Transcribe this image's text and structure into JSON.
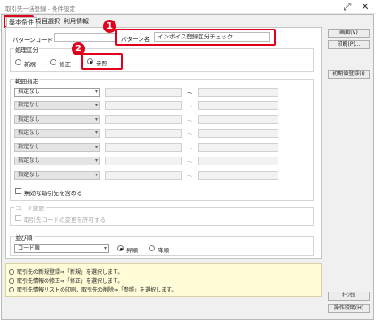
{
  "window": {
    "title": "取引先一括登録 - 条件設定"
  },
  "tabs": [
    "基本条件",
    "項目選択",
    "利用情報"
  ],
  "pattern": {
    "code_label": "パターンコード",
    "name_label": "パターン名",
    "name_value": "インボイス登録区分チェック"
  },
  "process": {
    "label": "処理区分",
    "options": [
      "新規",
      "修正",
      "参照"
    ],
    "selected": "参照"
  },
  "range": {
    "label": "範囲指定",
    "first_value": "指定なし",
    "rows": [
      "指定なし",
      "指定なし",
      "指定なし",
      "指定なし",
      "指定なし",
      "指定なし",
      "指定なし",
      "指定なし"
    ],
    "tilde": "～"
  },
  "include_invalid": {
    "label": "無効な取引先を含める"
  },
  "code_change": {
    "label": "コード変更",
    "allow_label": "取引先コードの変更を許可する"
  },
  "sort": {
    "label": "並び順",
    "value": "コード順",
    "options": [
      "昇順",
      "降順"
    ],
    "selected": "昇順"
  },
  "buttons": {
    "open": "画面(V)",
    "print": "印刷(P)...",
    "init": "初期値登録(I)",
    "cancel": "ｷｬﾝｾﾙ",
    "help": "操作説明(H)"
  },
  "info_lines": [
    "取引先の新規登録⇒「新規」を選択します。",
    "取引先情報の修正⇒「修正」を選択します。",
    "取引先情報リストの印刷、取引先の削除⇒「参照」を選択します。"
  ],
  "callouts": [
    "1",
    "2"
  ],
  "colors": {
    "highlight": "#e0001b",
    "info_bg": "#fffcd7"
  }
}
